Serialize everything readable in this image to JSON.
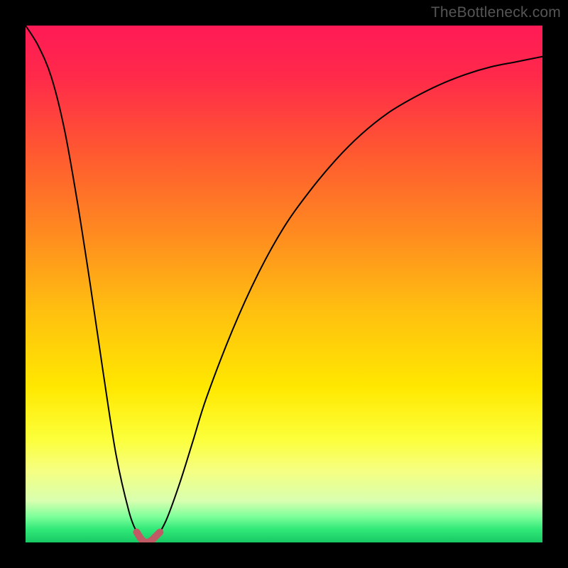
{
  "watermark": "TheBottleneck.com",
  "colors": {
    "background": "#000000",
    "gradient_stops": [
      {
        "offset": 0.0,
        "color": "#ff1a56"
      },
      {
        "offset": 0.1,
        "color": "#ff2a4a"
      },
      {
        "offset": 0.25,
        "color": "#ff5a30"
      },
      {
        "offset": 0.4,
        "color": "#ff8a20"
      },
      {
        "offset": 0.55,
        "color": "#ffbf10"
      },
      {
        "offset": 0.7,
        "color": "#ffe800"
      },
      {
        "offset": 0.8,
        "color": "#fcff3a"
      },
      {
        "offset": 0.86,
        "color": "#f6ff80"
      },
      {
        "offset": 0.92,
        "color": "#d8ffb0"
      },
      {
        "offset": 0.95,
        "color": "#7dff9a"
      },
      {
        "offset": 0.975,
        "color": "#30e878"
      },
      {
        "offset": 1.0,
        "color": "#18c964"
      }
    ],
    "curve": "#000000",
    "marker": "#c05a64"
  },
  "chart_data": {
    "type": "line",
    "title": "",
    "xlabel": "",
    "ylabel": "",
    "xlim": [
      0,
      1
    ],
    "ylim": [
      0,
      100
    ],
    "x": [
      0.0,
      0.025,
      0.05,
      0.075,
      0.1,
      0.125,
      0.15,
      0.175,
      0.2,
      0.215,
      0.225,
      0.235,
      0.245,
      0.25,
      0.26,
      0.275,
      0.3,
      0.325,
      0.35,
      0.4,
      0.45,
      0.5,
      0.55,
      0.6,
      0.65,
      0.7,
      0.75,
      0.8,
      0.85,
      0.9,
      0.95,
      1.0
    ],
    "values": [
      100,
      96,
      90,
      80,
      66,
      50,
      33,
      17,
      6,
      2,
      0.5,
      0,
      0.5,
      1,
      2,
      5,
      12,
      20,
      28,
      41,
      52,
      61,
      68,
      74,
      79,
      83,
      86,
      88.5,
      90.5,
      92,
      93,
      94
    ],
    "marker_range_x": [
      0.212,
      0.26
    ]
  }
}
